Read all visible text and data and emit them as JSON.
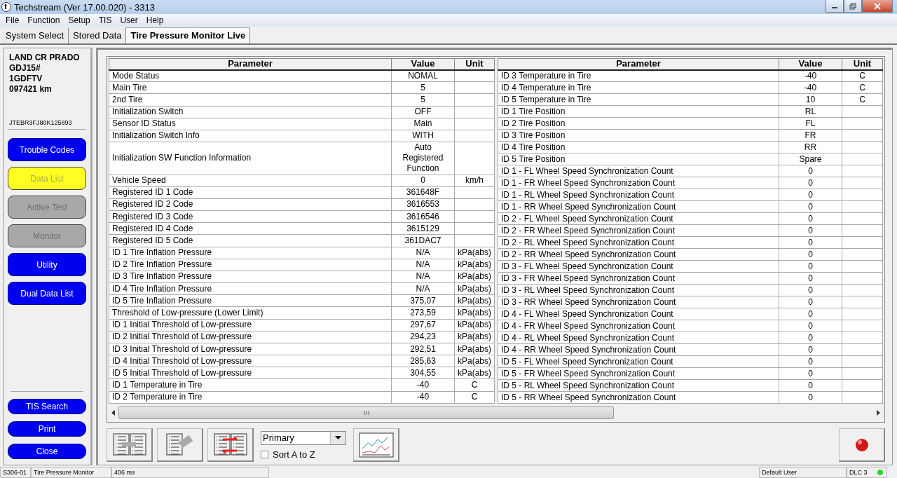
{
  "window": {
    "title": "Techstream (Ver 17.00.020) - 3313"
  },
  "menu": [
    "File",
    "Function",
    "Setup",
    "TIS",
    "User",
    "Help"
  ],
  "tabs": [
    {
      "label": "System Select",
      "selected": false
    },
    {
      "label": "Stored Data",
      "selected": false
    },
    {
      "label": "Tire Pressure Monitor Live",
      "selected": true
    }
  ],
  "vehicle": {
    "lines": [
      "LAND CR PRADO",
      "GDJ15#",
      "1GDFTV",
      "097421 km"
    ],
    "vin": "JTEBR3FJ80K125893"
  },
  "sidebar": {
    "buttons": [
      {
        "label": "Trouble Codes",
        "selected": false,
        "disabled": false
      },
      {
        "label": "Data List",
        "selected": true,
        "disabled": false
      },
      {
        "label": "Active Test",
        "selected": false,
        "disabled": true
      },
      {
        "label": "Monitor",
        "selected": false,
        "disabled": true
      },
      {
        "label": "Utility",
        "selected": false,
        "disabled": false
      },
      {
        "label": "Dual Data List",
        "selected": false,
        "disabled": false
      }
    ],
    "bottom_buttons": [
      "TIS Search",
      "Print",
      "Close"
    ]
  },
  "tables": [
    {
      "columns": [
        "Parameter",
        "Value",
        "Unit"
      ],
      "rows": [
        {
          "parameter": "Mode Status",
          "value": "NOMAL",
          "unit": ""
        },
        {
          "parameter": "Main Tire",
          "value": "5",
          "unit": ""
        },
        {
          "parameter": "2nd Tire",
          "value": "5",
          "unit": ""
        },
        {
          "parameter": "Initialization Switch",
          "value": "OFF",
          "unit": ""
        },
        {
          "parameter": "Sensor ID Status",
          "value": "Main",
          "unit": ""
        },
        {
          "parameter": "Initialization Switch Info",
          "value": "WITH",
          "unit": ""
        },
        {
          "parameter": "Initialization SW Function Information",
          "value": "Auto Registered Function",
          "unit": ""
        },
        {
          "parameter": "Vehicle Speed",
          "value": "0",
          "unit": "km/h"
        },
        {
          "parameter": "Registered ID 1 Code",
          "value": "361648F",
          "unit": ""
        },
        {
          "parameter": "Registered ID 2 Code",
          "value": "3616553",
          "unit": ""
        },
        {
          "parameter": "Registered ID 3 Code",
          "value": "3616546",
          "unit": ""
        },
        {
          "parameter": "Registered ID 4 Code",
          "value": "3615129",
          "unit": ""
        },
        {
          "parameter": "Registered ID 5 Code",
          "value": "361DAC7",
          "unit": ""
        },
        {
          "parameter": "ID 1 Tire Inflation Pressure",
          "value": "N/A",
          "unit": "kPa(abs)"
        },
        {
          "parameter": "ID 2 Tire Inflation Pressure",
          "value": "N/A",
          "unit": "kPa(abs)"
        },
        {
          "parameter": "ID 3 Tire Inflation Pressure",
          "value": "N/A",
          "unit": "kPa(abs)"
        },
        {
          "parameter": "ID 4 Tire Inflation Pressure",
          "value": "N/A",
          "unit": "kPa(abs)"
        },
        {
          "parameter": "ID 5 Tire Inflation Pressure",
          "value": "375,07",
          "unit": "kPa(abs)"
        },
        {
          "parameter": "Threshold of Low-pressure (Lower Limit)",
          "value": "273,59",
          "unit": "kPa(abs)"
        },
        {
          "parameter": "ID 1 Initial Threshold of Low-pressure",
          "value": "297,67",
          "unit": "kPa(abs)"
        },
        {
          "parameter": "ID 2 Initial Threshold of Low-pressure",
          "value": "294,23",
          "unit": "kPa(abs)"
        },
        {
          "parameter": "ID 3 Initial Threshold of Low-pressure",
          "value": "292,51",
          "unit": "kPa(abs)"
        },
        {
          "parameter": "ID 4 Initial Threshold of Low-pressure",
          "value": "285,63",
          "unit": "kPa(abs)"
        },
        {
          "parameter": "ID 5 Initial Threshold of Low-pressure",
          "value": "304,55",
          "unit": "kPa(abs)"
        },
        {
          "parameter": "ID 1 Temperature in Tire",
          "value": "-40",
          "unit": "C"
        },
        {
          "parameter": "ID 2 Temperature in Tire",
          "value": "-40",
          "unit": "C"
        }
      ]
    },
    {
      "columns": [
        "Parameter",
        "Value",
        "Unit"
      ],
      "rows": [
        {
          "parameter": "ID 3 Temperature in Tire",
          "value": "-40",
          "unit": "C"
        },
        {
          "parameter": "ID 4 Temperature in Tire",
          "value": "-40",
          "unit": "C"
        },
        {
          "parameter": "ID 5 Temperature in Tire",
          "value": "10",
          "unit": "C"
        },
        {
          "parameter": "ID 1 Tire Position",
          "value": "RL",
          "unit": ""
        },
        {
          "parameter": "ID 2 Tire Position",
          "value": "FL",
          "unit": ""
        },
        {
          "parameter": "ID 3 Tire Position",
          "value": "FR",
          "unit": ""
        },
        {
          "parameter": "ID 4 Tire Position",
          "value": "RR",
          "unit": ""
        },
        {
          "parameter": "ID 5 Tire Position",
          "value": "Spare",
          "unit": ""
        },
        {
          "parameter": "ID 1 - FL Wheel Speed Synchronization Count",
          "value": "0",
          "unit": ""
        },
        {
          "parameter": "ID 1 - FR Wheel Speed Synchronization Count",
          "value": "0",
          "unit": ""
        },
        {
          "parameter": "ID 1 - RL Wheel Speed Synchronization Count",
          "value": "0",
          "unit": ""
        },
        {
          "parameter": "ID 1 - RR Wheel Speed Synchronization Count",
          "value": "0",
          "unit": ""
        },
        {
          "parameter": "ID 2 - FL Wheel Speed Synchronization Count",
          "value": "0",
          "unit": ""
        },
        {
          "parameter": "ID 2 - FR Wheel Speed Synchronization Count",
          "value": "0",
          "unit": ""
        },
        {
          "parameter": "ID 2 - RL Wheel Speed Synchronization Count",
          "value": "0",
          "unit": ""
        },
        {
          "parameter": "ID 2 - RR Wheel Speed Synchronization Count",
          "value": "0",
          "unit": ""
        },
        {
          "parameter": "ID 3 - FL Wheel Speed Synchronization Count",
          "value": "0",
          "unit": ""
        },
        {
          "parameter": "ID 3 - FR Wheel Speed Synchronization Count",
          "value": "0",
          "unit": ""
        },
        {
          "parameter": "ID 3 - RL Wheel Speed Synchronization Count",
          "value": "0",
          "unit": ""
        },
        {
          "parameter": "ID 3 - RR Wheel Speed Synchronization Count",
          "value": "0",
          "unit": ""
        },
        {
          "parameter": "ID 4 - FL Wheel Speed Synchronization Count",
          "value": "0",
          "unit": ""
        },
        {
          "parameter": "ID 4 - FR Wheel Speed Synchronization Count",
          "value": "0",
          "unit": ""
        },
        {
          "parameter": "ID 4 - RL Wheel Speed Synchronization Count",
          "value": "0",
          "unit": ""
        },
        {
          "parameter": "ID 4 - RR Wheel Speed Synchronization Count",
          "value": "0",
          "unit": ""
        },
        {
          "parameter": "ID 5 - FL Wheel Speed Synchronization Count",
          "value": "0",
          "unit": ""
        },
        {
          "parameter": "ID 5 - FR Wheel Speed Synchronization Count",
          "value": "0",
          "unit": ""
        },
        {
          "parameter": "ID 5 - RL Wheel Speed Synchronization Count",
          "value": "0",
          "unit": ""
        },
        {
          "parameter": "ID 5 - RR Wheel Speed Synchronization Count",
          "value": "0",
          "unit": ""
        }
      ]
    }
  ],
  "toolbar": {
    "dropdown": {
      "value": "Primary"
    },
    "sort": {
      "label": "Sort A to Z",
      "checked": false
    }
  },
  "status_bar": {
    "code": "S306-01",
    "system": "Tire Pressure Monitor",
    "time": "406 ms",
    "user": "Default User",
    "connection": {
      "label": "DLC 3",
      "connected": true
    }
  }
}
